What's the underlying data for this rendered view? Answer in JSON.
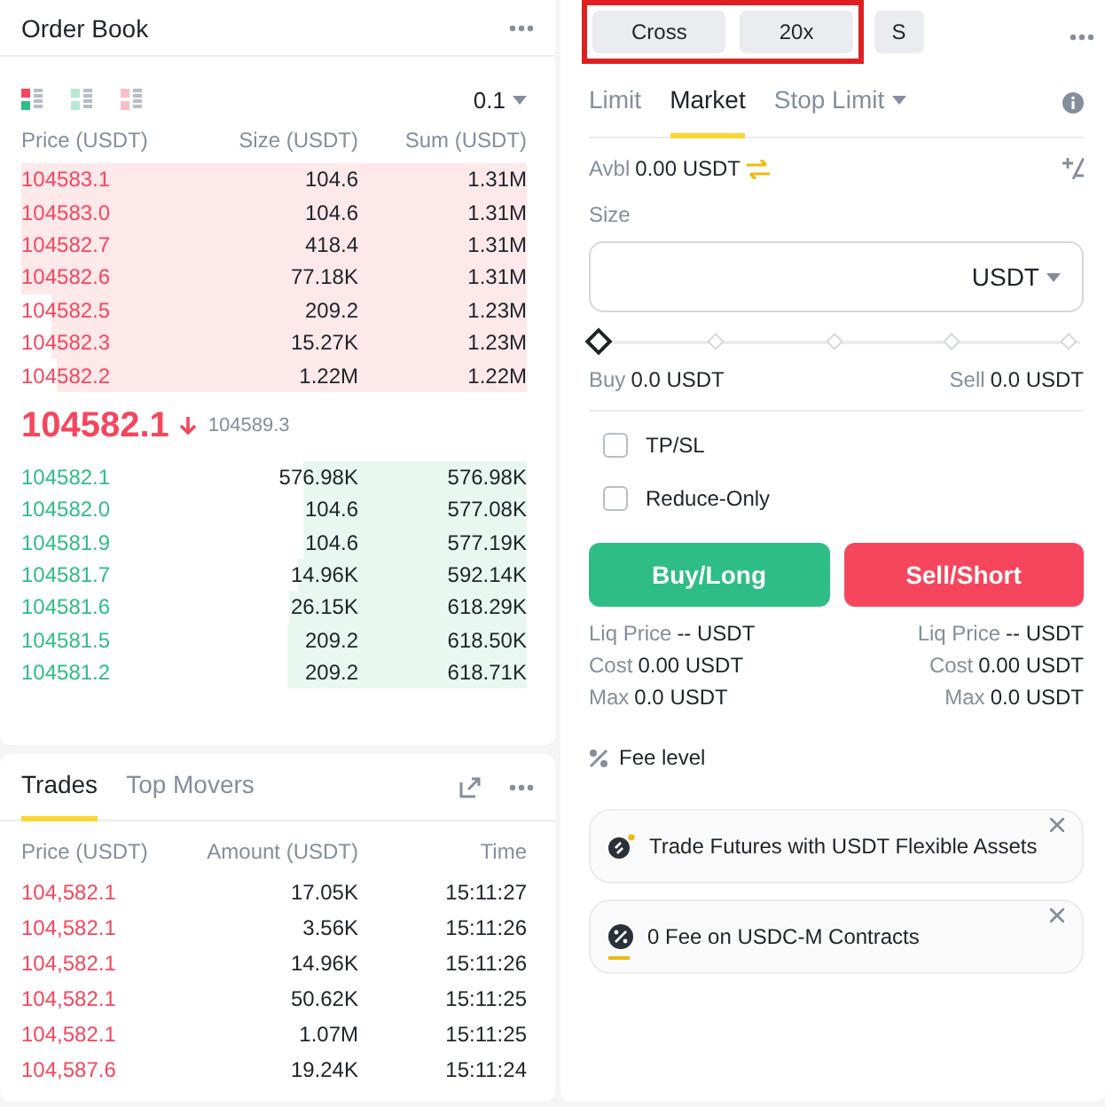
{
  "order_book": {
    "title": "Order Book",
    "precision": "0.1",
    "columns": [
      "Price (USDT)",
      "Size (USDT)",
      "Sum (USDT)"
    ],
    "asks": [
      {
        "price": "104583.1",
        "size": "104.6",
        "sum": "1.31M"
      },
      {
        "price": "104583.0",
        "size": "104.6",
        "sum": "1.31M"
      },
      {
        "price": "104582.7",
        "size": "418.4",
        "sum": "1.31M"
      },
      {
        "price": "104582.6",
        "size": "77.18K",
        "sum": "1.31M"
      },
      {
        "price": "104582.5",
        "size": "209.2",
        "sum": "1.23M"
      },
      {
        "price": "104582.3",
        "size": "15.27K",
        "sum": "1.23M"
      },
      {
        "price": "104582.2",
        "size": "1.22M",
        "sum": "1.22M"
      }
    ],
    "last_price": "104582.1",
    "price_falling": true,
    "mark_price": "104589.3",
    "bids": [
      {
        "price": "104582.1",
        "size": "576.98K",
        "sum": "576.98K"
      },
      {
        "price": "104582.0",
        "size": "104.6",
        "sum": "577.08K"
      },
      {
        "price": "104581.9",
        "size": "104.6",
        "sum": "577.19K"
      },
      {
        "price": "104581.7",
        "size": "14.96K",
        "sum": "592.14K"
      },
      {
        "price": "104581.6",
        "size": "26.15K",
        "sum": "618.29K"
      },
      {
        "price": "104581.5",
        "size": "209.2",
        "sum": "618.50K"
      },
      {
        "price": "104581.2",
        "size": "209.2",
        "sum": "618.71K"
      }
    ]
  },
  "trades": {
    "tabs": [
      {
        "label": "Trades",
        "selected": true
      },
      {
        "label": "Top Movers",
        "selected": false
      }
    ],
    "columns": [
      "Price (USDT)",
      "Amount (USDT)",
      "Time"
    ],
    "rows": [
      {
        "price": "104,582.1",
        "amount": "17.05K",
        "time": "15:11:27"
      },
      {
        "price": "104,582.1",
        "amount": "3.56K",
        "time": "15:11:26"
      },
      {
        "price": "104,582.1",
        "amount": "14.96K",
        "time": "15:11:26"
      },
      {
        "price": "104,582.1",
        "amount": "50.62K",
        "time": "15:11:25"
      },
      {
        "price": "104,582.1",
        "amount": "1.07M",
        "time": "15:11:25"
      },
      {
        "price": "104,587.6",
        "amount": "19.24K",
        "time": "15:11:24"
      }
    ]
  },
  "order_form": {
    "mode_buttons": [
      {
        "label": "Cross",
        "highlighted": true
      },
      {
        "label": "20x",
        "highlighted": true
      },
      {
        "label": "S",
        "highlighted": false
      }
    ],
    "tabs": [
      {
        "label": "Limit",
        "selected": false
      },
      {
        "label": "Market",
        "selected": true
      },
      {
        "label": "Stop Limit",
        "selected": false
      }
    ],
    "available_label": "Avbl",
    "available": "0.00 USDT",
    "size_label": "Size",
    "size_unit": "USDT",
    "slider": {
      "level": 0
    },
    "buy_amount_label": "Buy",
    "buy_amount": "0.0 USDT",
    "sell_amount_label": "Sell",
    "sell_amount": "0.0 USDT",
    "options": [
      {
        "label": "TP/SL",
        "checked": false
      },
      {
        "label": "Reduce-Only",
        "checked": false
      }
    ],
    "buy_button": "Buy/Long",
    "sell_button": "Sell/Short",
    "buy_info": [
      {
        "label": "Liq Price",
        "value": "-- USDT"
      },
      {
        "label": "Cost",
        "value": "0.00 USDT"
      },
      {
        "label": "Max",
        "value": "0.0 USDT"
      }
    ],
    "sell_info": [
      {
        "label": "Liq Price",
        "value": "-- USDT"
      },
      {
        "label": "Cost",
        "value": "0.00 USDT"
      },
      {
        "label": "Max",
        "value": "0.0 USDT"
      }
    ],
    "fee_level": "Fee level",
    "banners": [
      {
        "text": "Trade Futures with USDT Flexible Assets",
        "kind": "flexible"
      },
      {
        "text": "0 Fee on USDC-M Contracts",
        "kind": "fee"
      }
    ]
  }
}
